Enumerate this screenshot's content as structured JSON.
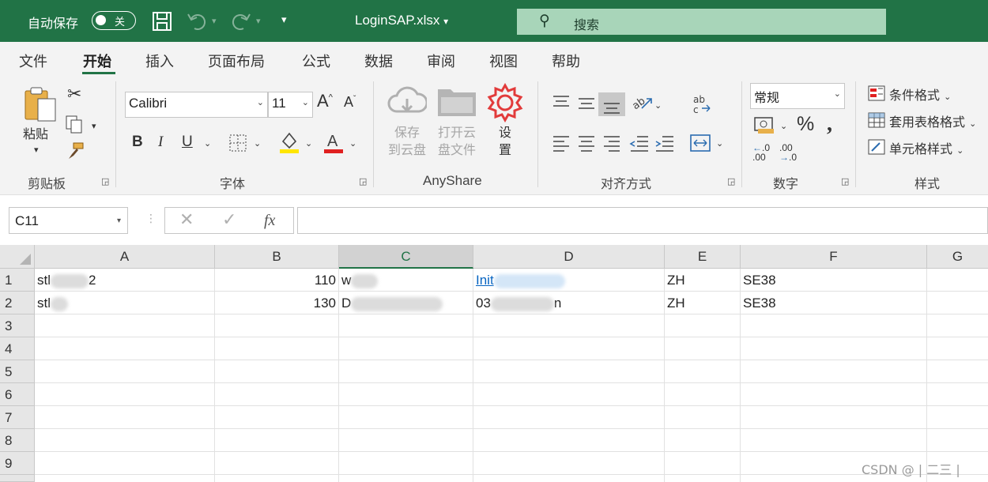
{
  "titlebar": {
    "autosave_label": "自动保存",
    "autosave_toggle": "关",
    "filename": "LoginSAP.xlsx",
    "search_placeholder": "搜索"
  },
  "tabs": [
    "文件",
    "开始",
    "插入",
    "页面布局",
    "公式",
    "数据",
    "审阅",
    "视图",
    "帮助"
  ],
  "active_tab": "开始",
  "ribbon": {
    "clipboard": {
      "label": "剪贴板",
      "paste": "粘贴"
    },
    "font": {
      "label": "字体",
      "family": "Calibri",
      "size": "11"
    },
    "anyshare": {
      "label": "AnyShare",
      "save_cloud_1": "保存",
      "save_cloud_2": "到云盘",
      "open_cloud_1": "打开云",
      "open_cloud_2": "盘文件",
      "settings_1": "设",
      "settings_2": "置"
    },
    "alignment": {
      "label": "对齐方式"
    },
    "number": {
      "label": "数字",
      "format": "常规"
    },
    "styles": {
      "label": "样式",
      "conditional": "条件格式",
      "table": "套用表格格式",
      "cell": "单元格样式"
    }
  },
  "formula_bar": {
    "name_box": "C11",
    "fx": "fx",
    "formula": ""
  },
  "grid": {
    "columns": [
      "A",
      "B",
      "C",
      "D",
      "E",
      "F",
      "G"
    ],
    "selected_column": "C",
    "rows": [
      "1",
      "2",
      "3",
      "4",
      "5",
      "6",
      "7",
      "8",
      "9"
    ],
    "data": [
      {
        "a_start": "stl",
        "a_end": "2",
        "b": "110",
        "c": "w",
        "d": "Init",
        "e": "ZH",
        "f": "SE38"
      },
      {
        "a_start": "stl",
        "a_end": "",
        "b": "130",
        "c": "D",
        "d_start": "03",
        "d_end": "n",
        "e": "ZH",
        "f": "SE38"
      }
    ]
  },
  "colors": {
    "brand": "#217346",
    "link": "#0563c1",
    "search_bg": "#a8d5b9"
  },
  "watermark": "CSDN @ | 二三 |"
}
